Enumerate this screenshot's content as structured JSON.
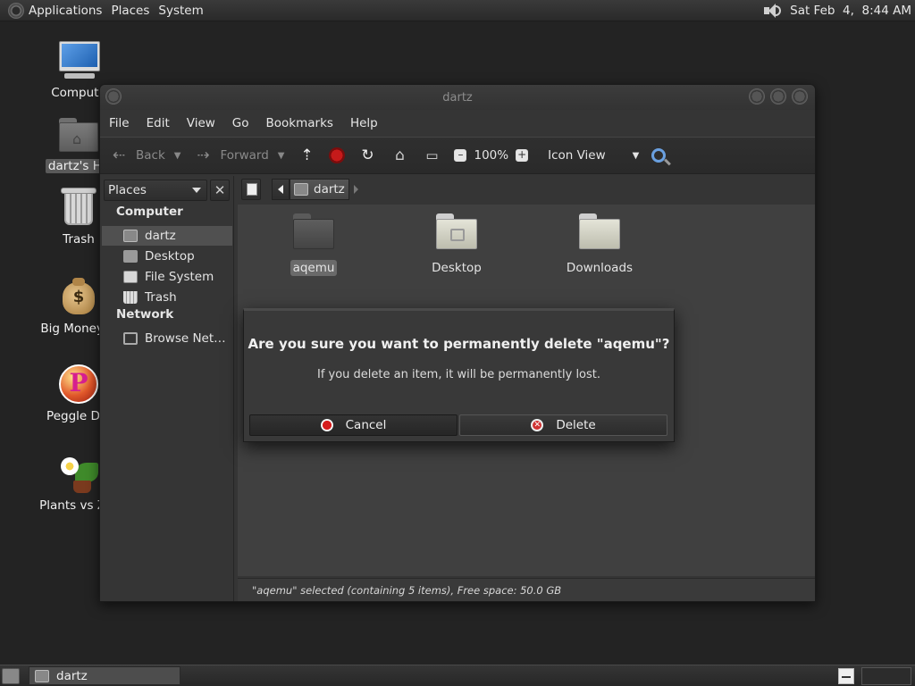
{
  "top_panel": {
    "menus": [
      "Applications",
      "Places",
      "System"
    ],
    "clock": "Sat Feb  4,  8:44 AM"
  },
  "desktop_icons": [
    {
      "label": "Compute",
      "icon": "computer-icon"
    },
    {
      "label": "dartz's Ho",
      "icon": "home-folder-icon"
    },
    {
      "label": "Trash",
      "icon": "trash-icon"
    },
    {
      "label": "Big Money D",
      "icon": "money-bag-icon"
    },
    {
      "label": "Peggle Del",
      "icon": "peggle-icon"
    },
    {
      "label": "Plants vs Zor",
      "icon": "plants-icon"
    }
  ],
  "window": {
    "title": "dartz",
    "menu": [
      "File",
      "Edit",
      "View",
      "Go",
      "Bookmarks",
      "Help"
    ],
    "toolbar": {
      "back": "Back",
      "forward": "Forward",
      "zoom": "100%",
      "view_mode": "Icon View"
    },
    "sidebar": {
      "combo": "Places",
      "close": "✕",
      "section_computer": "Computer",
      "section_network": "Network",
      "items": [
        "dartz",
        "Desktop",
        "File System",
        "Trash",
        "Browse Net…"
      ]
    },
    "path": {
      "current": "dartz"
    },
    "files": [
      {
        "name": "aqemu",
        "selected": true
      },
      {
        "name": "Desktop",
        "selected": false
      },
      {
        "name": "Downloads",
        "selected": false
      }
    ],
    "status": "\"aqemu\" selected (containing 5 items), Free space: 50.0 GB"
  },
  "dialog": {
    "title": "Are you sure you want to permanently delete \"aqemu\"?",
    "message": "If you delete an item, it will be permanently lost.",
    "cancel": "Cancel",
    "delete": "Delete"
  },
  "bottom_panel": {
    "task": "dartz"
  }
}
